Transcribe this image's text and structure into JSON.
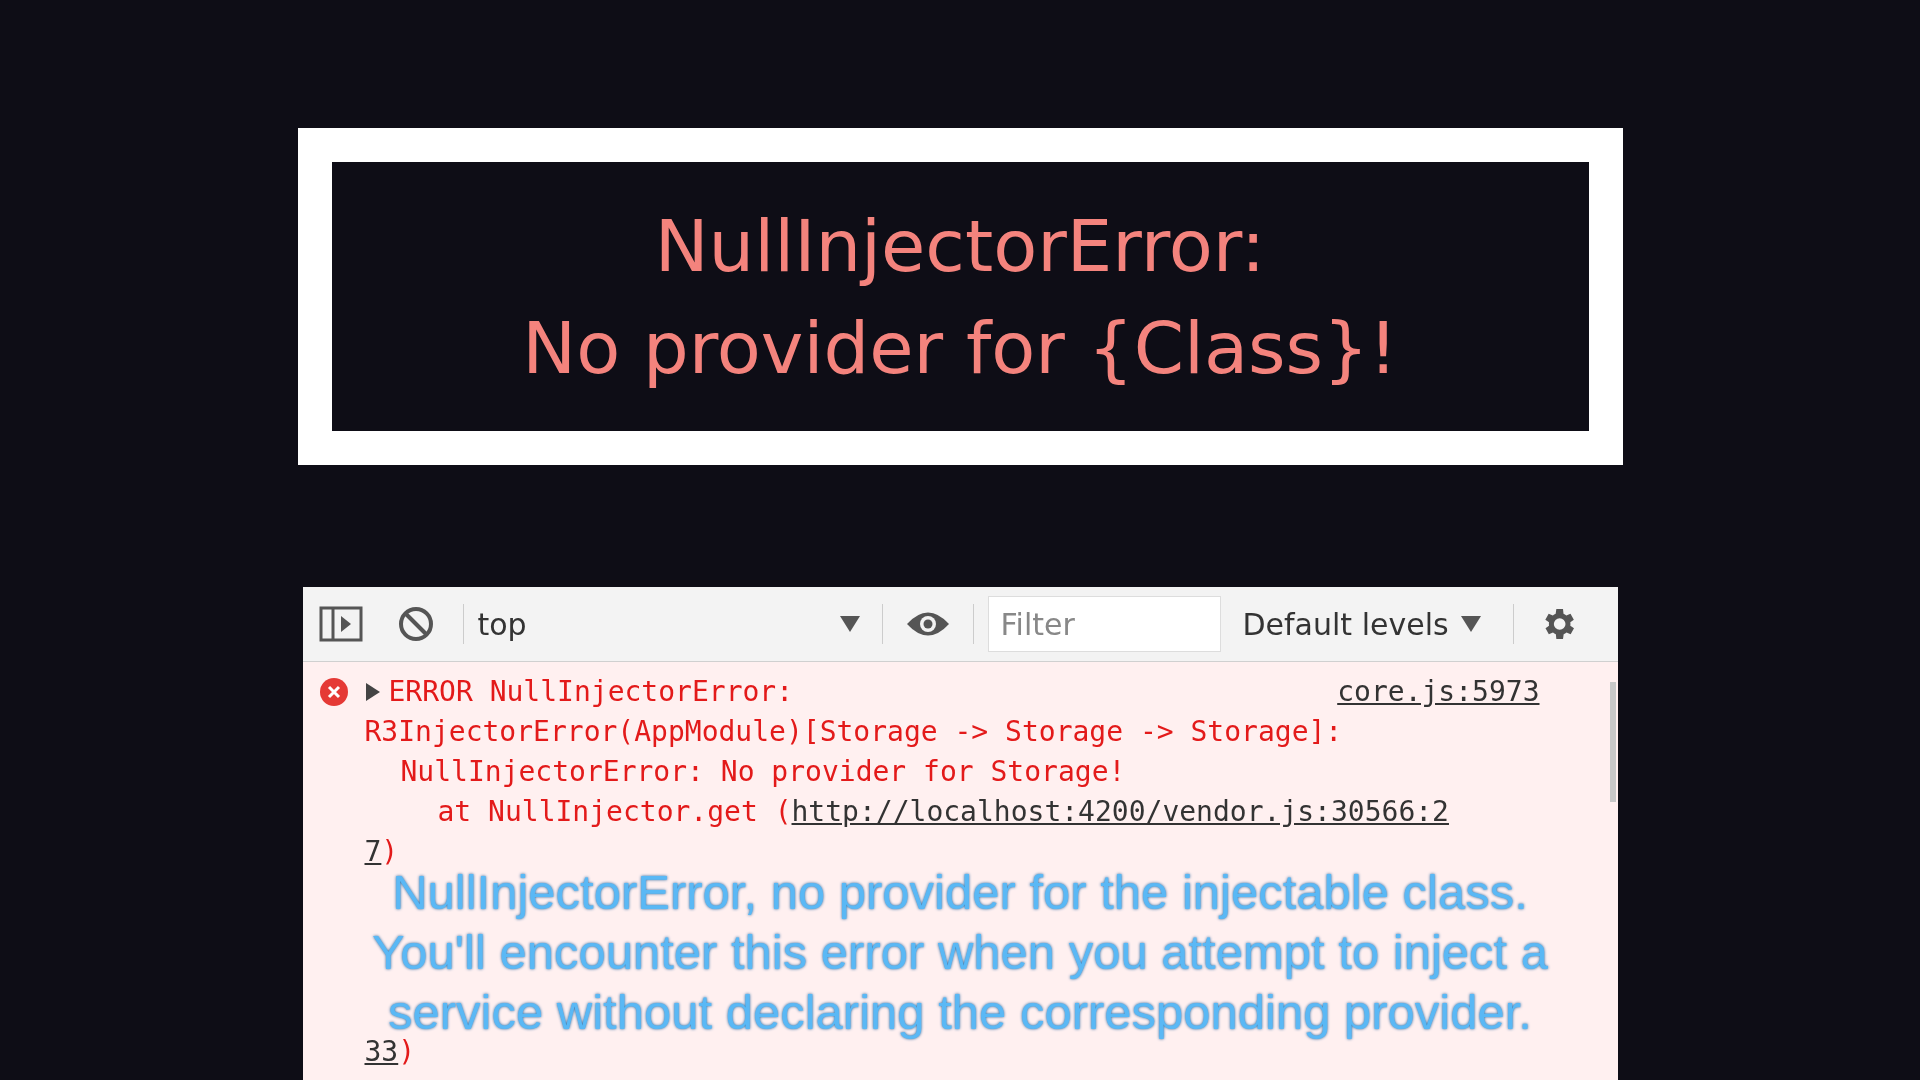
{
  "title_card": {
    "lines": [
      "NullInjectorError:",
      "No provider for {Class}!"
    ]
  },
  "console": {
    "toolbar": {
      "context": "top",
      "filter_placeholder": "Filter",
      "levels": "Default levels"
    },
    "error": {
      "expanded": false,
      "head": "ERROR NullInjectorError:",
      "source": "core.js:5973",
      "lines": [
        {
          "text": "R3InjectorError(AppModule)[Storage -> Storage -> Storage]:",
          "children": [
            {
              "text": "NullInjectorError: No provider for Storage!",
              "children": [
                {
                  "text": "at NullInjector.get (",
                  "link": "http://localhost:4200/vendor.js:30566:2"
                }
              ]
            }
          ]
        },
        {
          "link": "7",
          "text": ")"
        },
        {
          "link": "33",
          "text": ")"
        }
      ]
    }
  },
  "subtitle": [
    "NullInjectorError, no provider for the injectable class.",
    "You'll encounter this error when you attempt to inject a",
    "service without declaring the corresponding provider."
  ]
}
